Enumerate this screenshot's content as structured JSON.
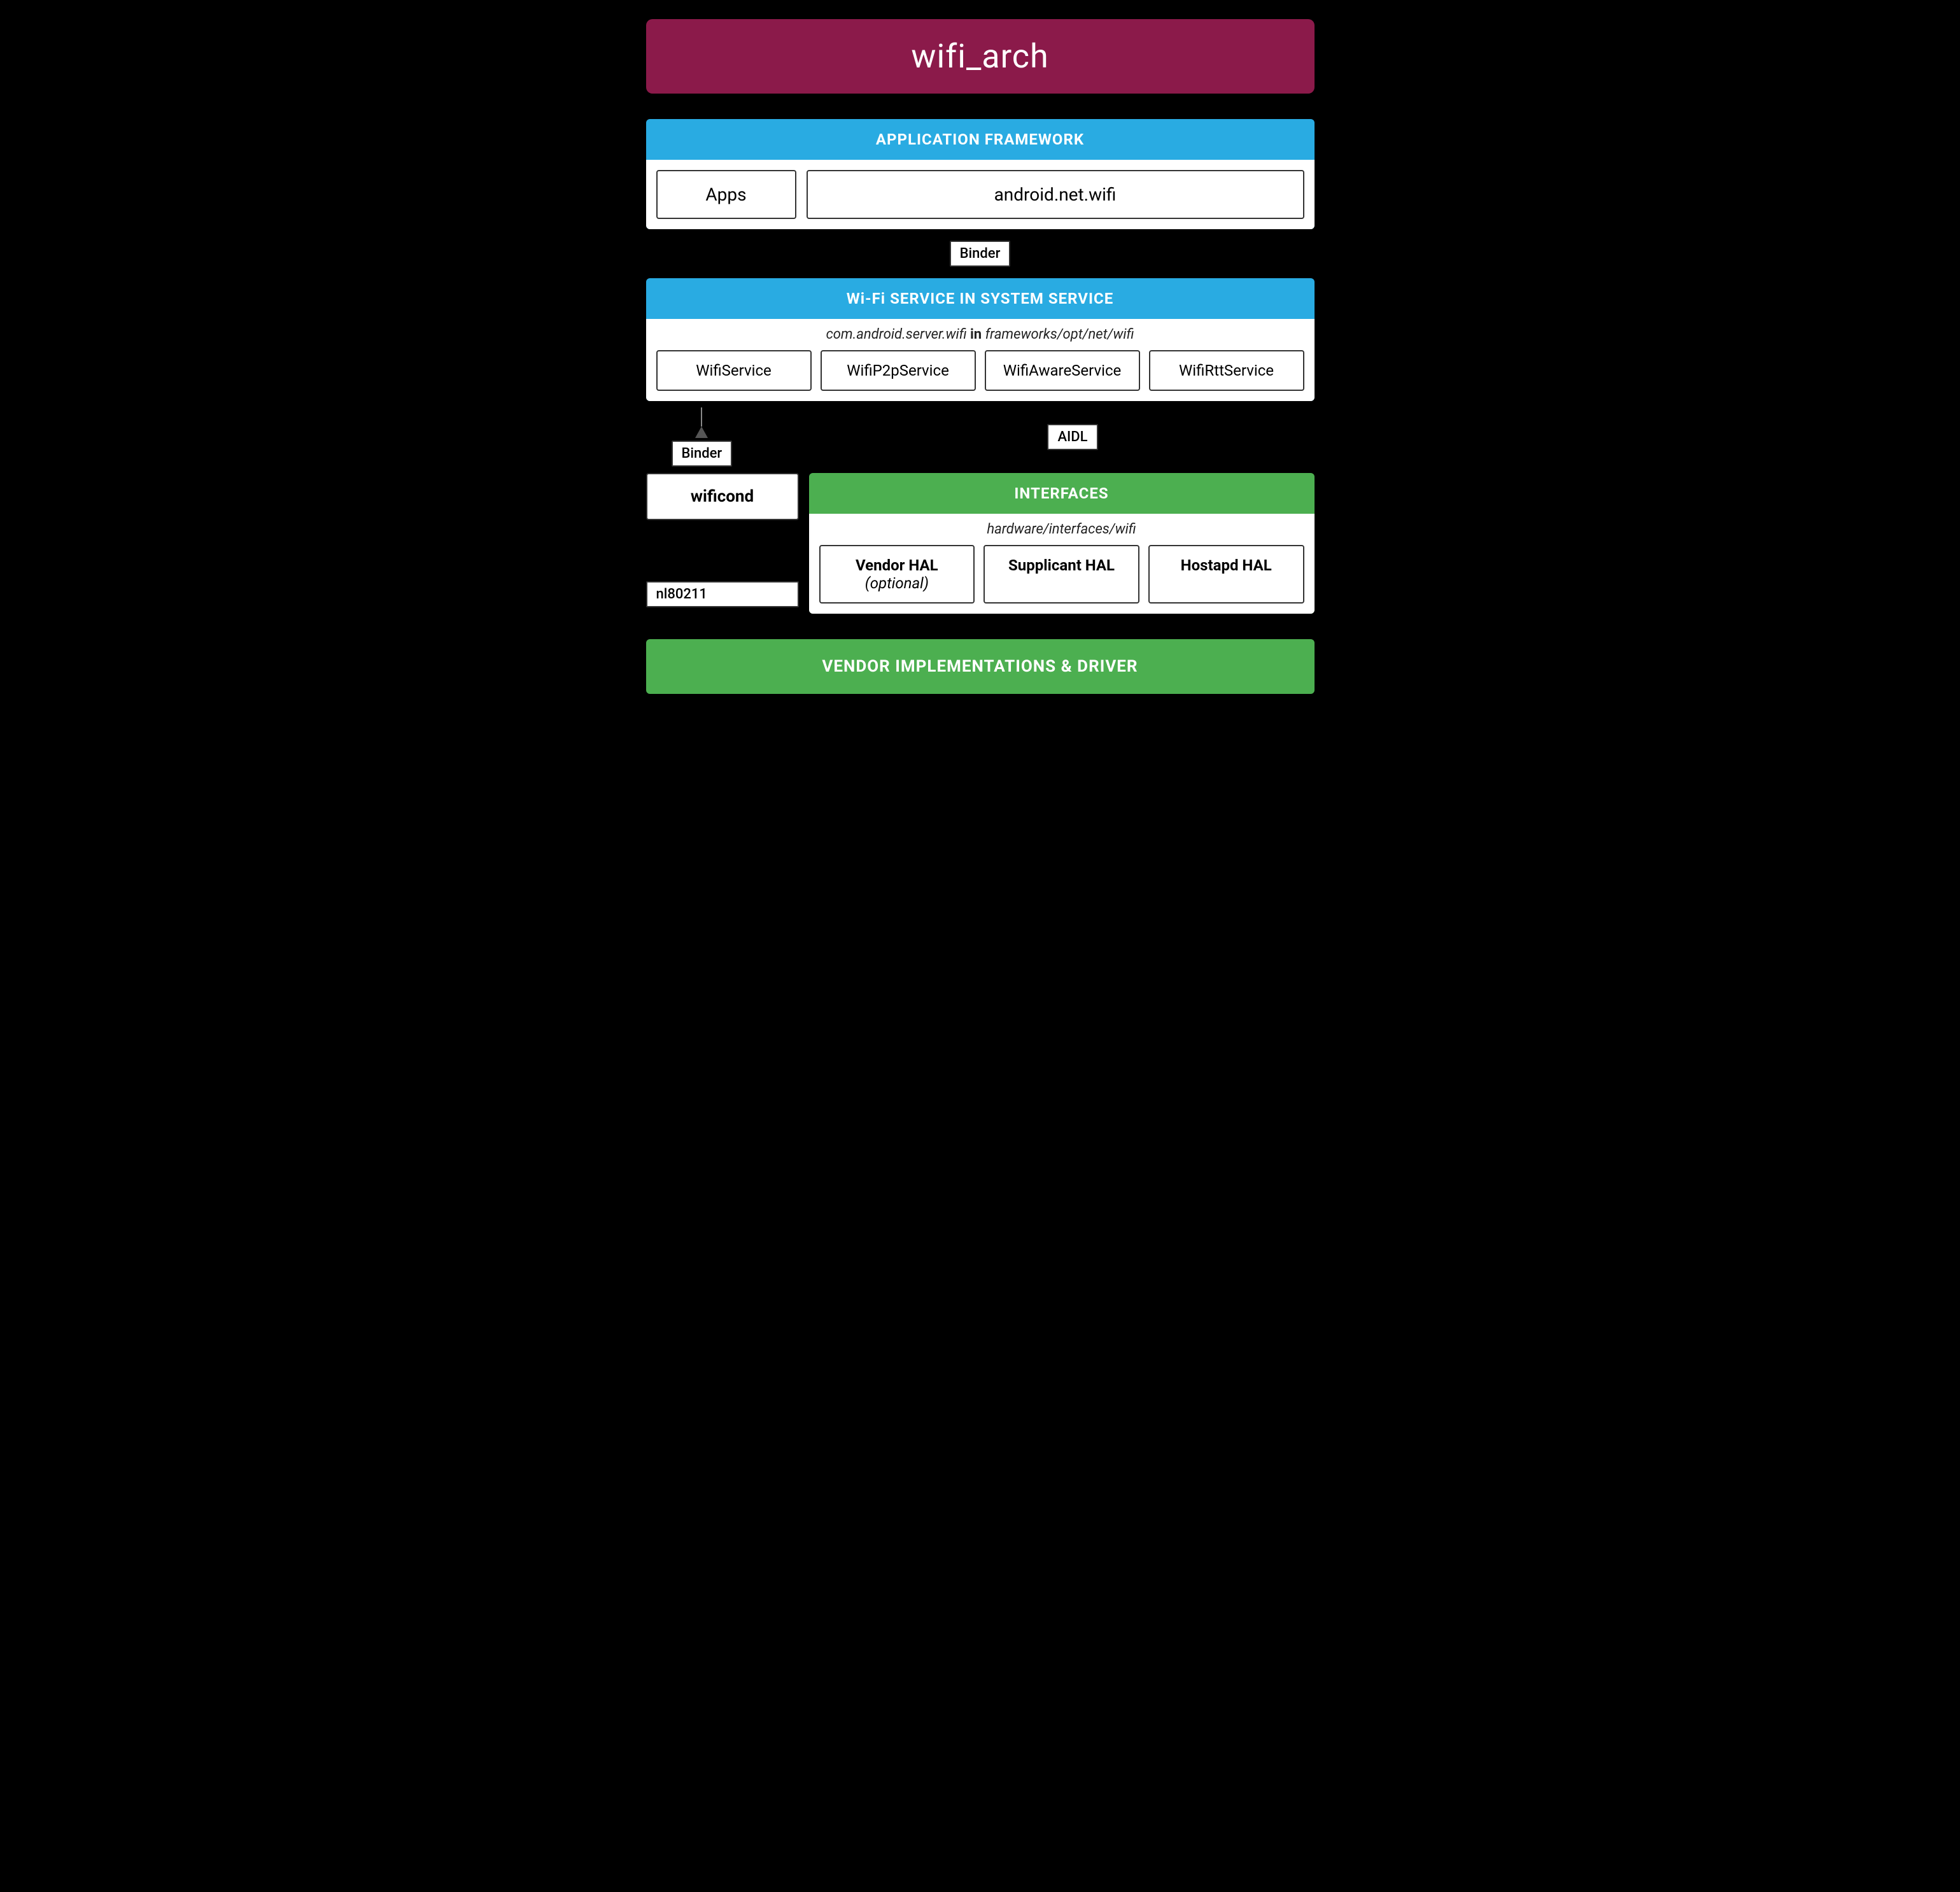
{
  "title": "wifi_arch",
  "sections": {
    "appFramework": {
      "header": "APPLICATION FRAMEWORK",
      "apps": "Apps",
      "androidNetWifi": "android.net.wifi"
    },
    "binder1": "Binder",
    "wifiService": {
      "header": "Wi-Fi SERVICE IN SYSTEM SERVICE",
      "path_prefix": "com.android.server.wifi",
      "path_bold": "in",
      "path_suffix": "frameworks/opt/net/wifi",
      "services": [
        "WifiService",
        "WifiP2pService",
        "WifiAwareService",
        "WifiRttService"
      ]
    },
    "binder2": "Binder",
    "aidl": "AIDL",
    "wificond": "wificond",
    "nl80211": "nl80211",
    "interfaces": {
      "header": "INTERFACES",
      "path": "hardware/interfaces/wifi",
      "hals": [
        "Vendor HAL (optional)",
        "Supplicant HAL",
        "Hostapd HAL"
      ]
    },
    "vendor": "VENDOR IMPLEMENTATIONS & DRIVER"
  }
}
